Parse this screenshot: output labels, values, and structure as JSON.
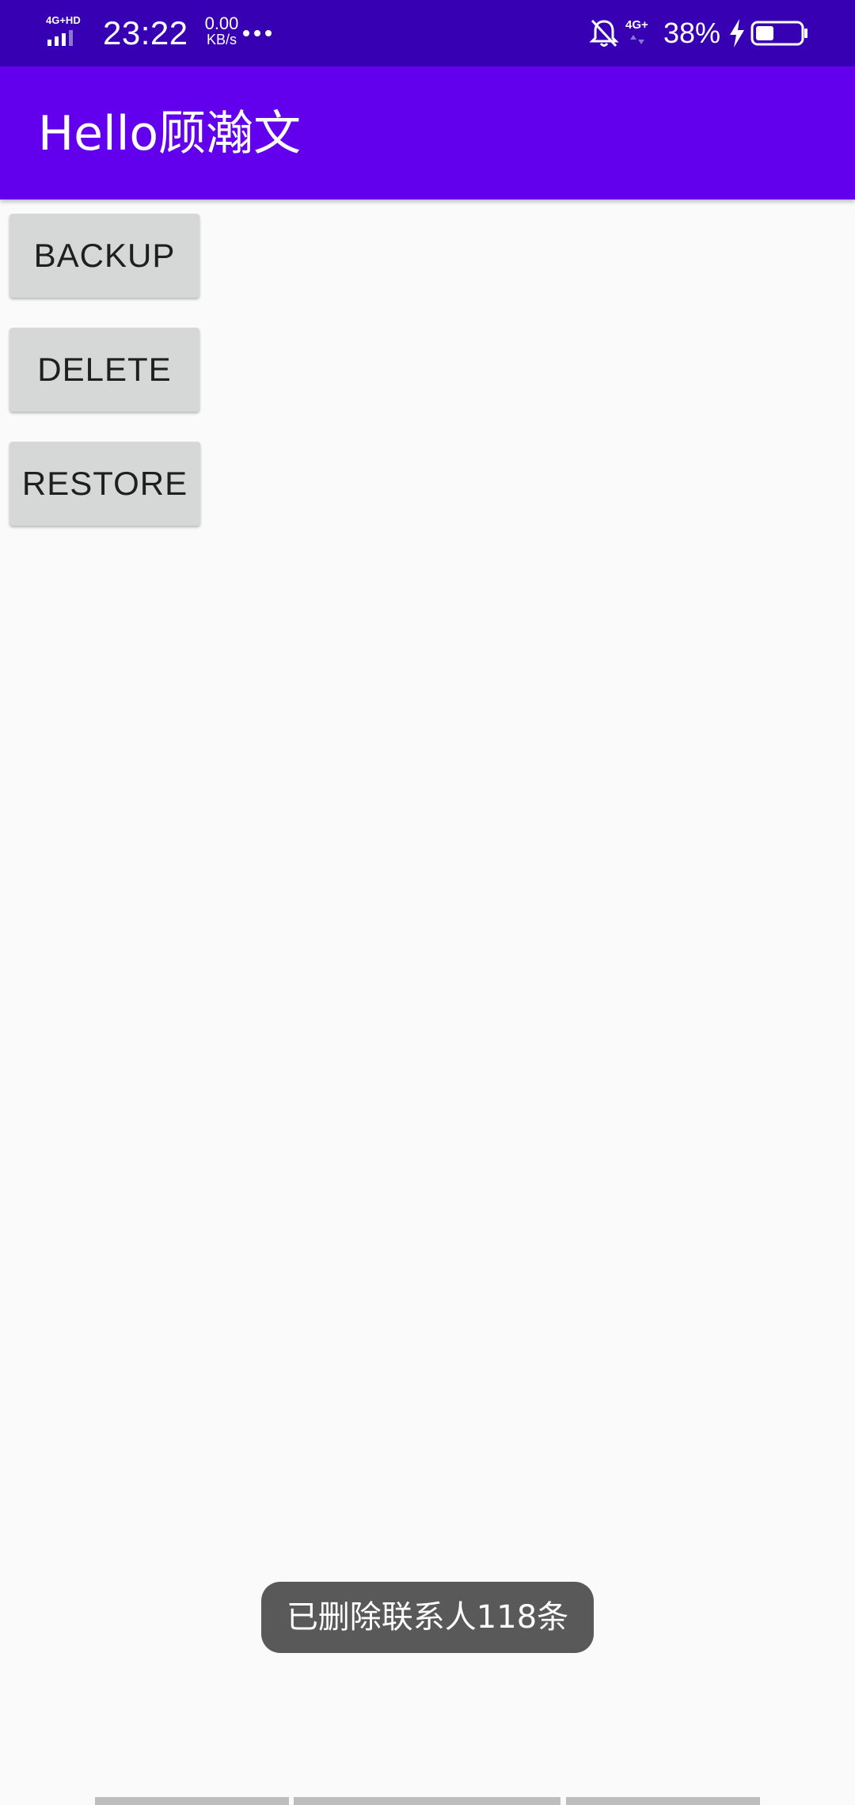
{
  "status_bar": {
    "network_label": "4G+HD",
    "time": "23:22",
    "speed_value": "0.00",
    "speed_unit": "KB/s",
    "network2_label": "4G+",
    "battery_percent": "38%",
    "icons": [
      "signal-icon",
      "more-icon",
      "mute-bell-icon",
      "network-icon",
      "charging-bolt-icon",
      "battery-icon"
    ]
  },
  "app_bar": {
    "title": "Hello顾瀚文"
  },
  "buttons": {
    "backup": "BACKUP",
    "delete": "DELETE",
    "restore": "RESTORE"
  },
  "toast": {
    "message": "已删除联系人118条"
  },
  "colors": {
    "status_bar": "#3700b3",
    "app_bar": "#6200ee",
    "background": "#fafafa",
    "button": "#d6d7d7",
    "toast": "#595959"
  }
}
